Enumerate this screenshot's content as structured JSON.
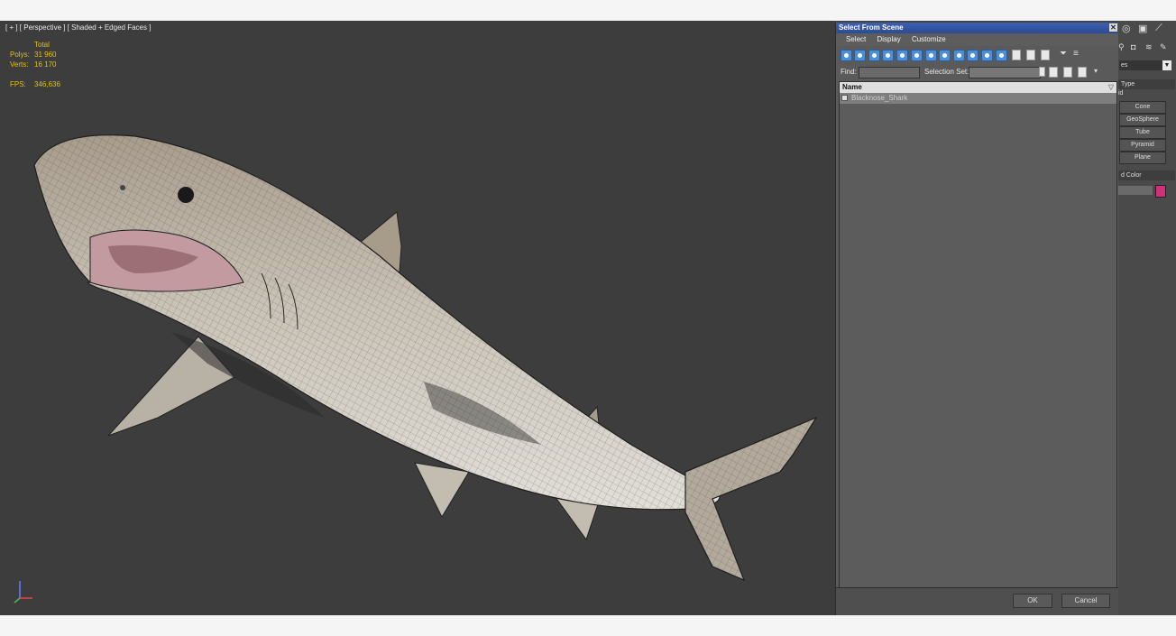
{
  "viewport": {
    "label": "[ + ] [ Perspective ] [ Shaded + Edged Faces ]",
    "stats": {
      "total_label": "Total",
      "polys_label": "Polys:",
      "polys_value": "31 960",
      "verts_label": "Verts:",
      "verts_value": "16 170",
      "fps_label": "FPS:",
      "fps_value": "346,636"
    }
  },
  "dialog": {
    "title": "Select From Scene",
    "close_icon": "✕",
    "menu": [
      "Select",
      "Display",
      "Customize"
    ],
    "find_label": "Find:",
    "selection_set_label": "Selection Set:",
    "column_name": "Name",
    "items": [
      {
        "name": "Blacknose_Shark"
      }
    ],
    "ok_label": "OK",
    "cancel_label": "Cancel"
  },
  "command_panel": {
    "dropdown_value": "es",
    "type_header": "Type",
    "type_partial": "id",
    "buttons": [
      "Cone",
      "GeoSphere",
      "Tube",
      "Pyramid",
      "Plane"
    ],
    "color_header": "d Color",
    "swatch_color": "#d0307a"
  },
  "colors": {
    "viewport_bg": "#3d3d3d",
    "stats_text": "#e6c200",
    "dialog_title": "#2c4b96",
    "toolbar_accent": "#4a8fd8"
  }
}
